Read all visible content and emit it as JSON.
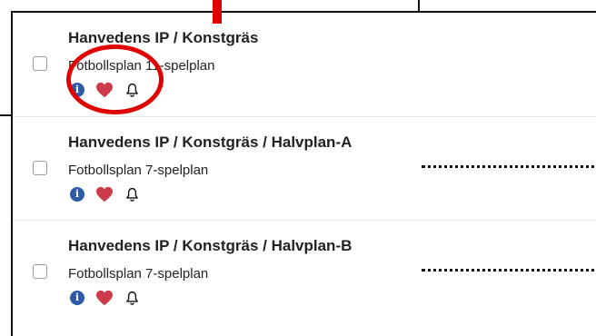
{
  "rows": [
    {
      "title": "Hanvedens IP / Konstgräs",
      "subtitle": "Fotbollsplan 11-spelplan"
    },
    {
      "title": "Hanvedens IP / Konstgräs / Halvplan-A",
      "subtitle": "Fotbollsplan 7-spelplan"
    },
    {
      "title": "Hanvedens IP / Konstgräs / Halvplan-B",
      "subtitle": "Fotbollsplan 7-spelplan"
    }
  ],
  "icons": {
    "info": "info-icon",
    "favorite": "heart-icon",
    "notify": "bell-icon",
    "info_glyph": "i"
  },
  "colors": {
    "info_blue": "#2c5aa6",
    "heart_red": "#cc3b4a",
    "annotation_red": "#e00000"
  }
}
